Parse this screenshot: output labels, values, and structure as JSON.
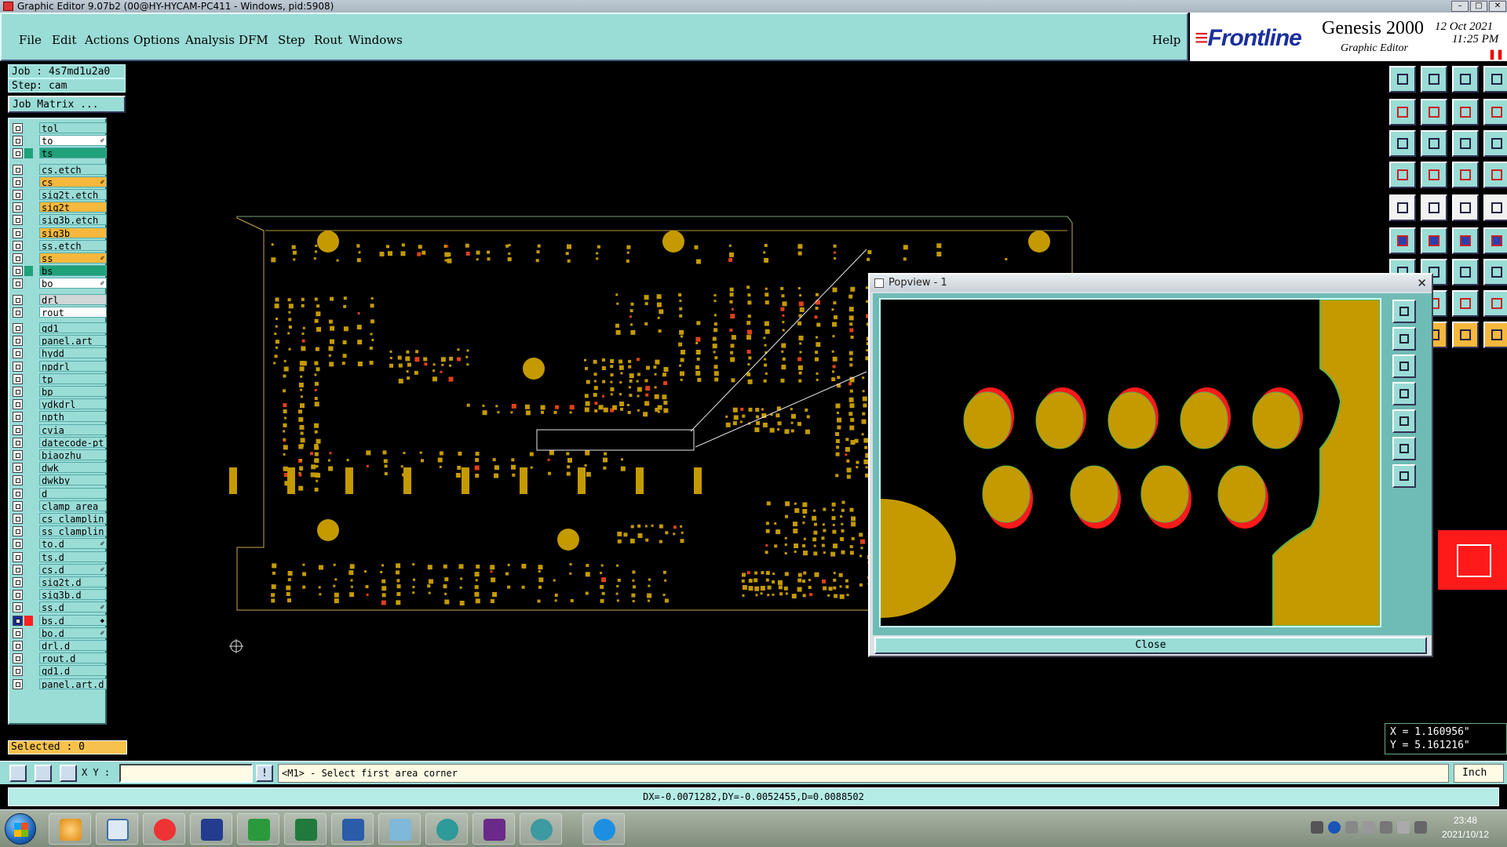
{
  "window": {
    "title": "Graphic Editor 9.07b2 (00@HY-HYCAM-PC411 - Windows, pid:5908)"
  },
  "menu": {
    "items": [
      "File",
      "Edit",
      "Actions",
      "Options",
      "Analysis",
      "DFM",
      "Step",
      "Rout",
      "Windows"
    ],
    "help": "Help"
  },
  "brand": {
    "logo_left": "Front",
    "logo_right": "line",
    "product": "Genesis 2000",
    "subtitle": "Graphic Editor",
    "date": "12 Oct 2021",
    "time": "11:25 PM",
    "pause_glyph": "❚❚"
  },
  "job": {
    "job_label": "Job : 4s7md1u2a0",
    "step_label": "Step: cam",
    "matrix_button": "Job Matrix ..."
  },
  "layers": [
    {
      "name": "tol",
      "style": "teal"
    },
    {
      "name": "to",
      "style": "white",
      "mark": "✐"
    },
    {
      "name": "ts",
      "style": "green"
    },
    {
      "name": "cs.etch",
      "style": "teal"
    },
    {
      "name": "cs",
      "style": "orange",
      "mark": "✐"
    },
    {
      "name": "sig2t.etch",
      "style": "teal"
    },
    {
      "name": "sig2t",
      "style": "orange"
    },
    {
      "name": "sig3b.etch",
      "style": "teal"
    },
    {
      "name": "sig3b",
      "style": "orange"
    },
    {
      "name": "ss.etch",
      "style": "teal"
    },
    {
      "name": "ss",
      "style": "orange",
      "mark": "✐"
    },
    {
      "name": "bs",
      "style": "green"
    },
    {
      "name": "bo",
      "style": "white",
      "mark": "✐"
    },
    {
      "name": "drl",
      "style": "gray"
    },
    {
      "name": "rout",
      "style": "white"
    },
    {
      "name": "gd1",
      "style": "teal"
    },
    {
      "name": "panel.art",
      "style": "teal"
    },
    {
      "name": "hydd",
      "style": "teal"
    },
    {
      "name": "npdrl",
      "style": "teal"
    },
    {
      "name": "tp",
      "style": "teal"
    },
    {
      "name": "bp",
      "style": "teal"
    },
    {
      "name": "ydkdrl",
      "style": "teal"
    },
    {
      "name": "npth",
      "style": "teal"
    },
    {
      "name": "cvia",
      "style": "teal"
    },
    {
      "name": "datecode-pt",
      "style": "teal"
    },
    {
      "name": "biaozhu",
      "style": "teal"
    },
    {
      "name": "dwk",
      "style": "teal"
    },
    {
      "name": "dwkby",
      "style": "teal"
    },
    {
      "name": "d",
      "style": "teal"
    },
    {
      "name": "clamp_area",
      "style": "teal"
    },
    {
      "name": "cs_clamplin",
      "style": "teal"
    },
    {
      "name": "ss_clamplin",
      "style": "teal"
    },
    {
      "name": "to.d",
      "style": "teal",
      "mark": "✐"
    },
    {
      "name": "ts.d",
      "style": "teal"
    },
    {
      "name": "cs.d",
      "style": "teal",
      "mark": "✐"
    },
    {
      "name": "sig2t.d",
      "style": "teal"
    },
    {
      "name": "sig3b.d",
      "style": "teal"
    },
    {
      "name": "ss.d",
      "style": "teal",
      "mark": "✐"
    },
    {
      "name": "bs.d",
      "style": "teal",
      "mark": "◆",
      "selected": true
    },
    {
      "name": "bo.d",
      "style": "teal",
      "mark": "✐"
    },
    {
      "name": "drl.d",
      "style": "teal"
    },
    {
      "name": "rout.d",
      "style": "teal"
    },
    {
      "name": "gd1.d",
      "style": "teal"
    },
    {
      "name": "panel.art.d",
      "style": "teal"
    }
  ],
  "selected_label": "Selected : 0",
  "popview": {
    "title": "Popview - 1",
    "close_glyph": "✕",
    "close_button": "Close"
  },
  "coords": {
    "x": "X = 1.160956\"",
    "y": "Y = 5.161216\""
  },
  "command": {
    "xy_label": "X Y :",
    "xy_value": "",
    "bang": "!",
    "prompt": "<M1> - Select first area corner",
    "unit": "Inch"
  },
  "status": {
    "delta": "DX=-0.0071282,DY=-0.0052455,D=0.0088502"
  },
  "taskbar": {
    "time": "23:48",
    "date": "2021/10/12"
  },
  "colors": {
    "copper": "#c49a00",
    "solder_mask": "#ff1a1a",
    "panel_teal": "#9adcd6",
    "highlight_orange": "#f6b83c"
  }
}
